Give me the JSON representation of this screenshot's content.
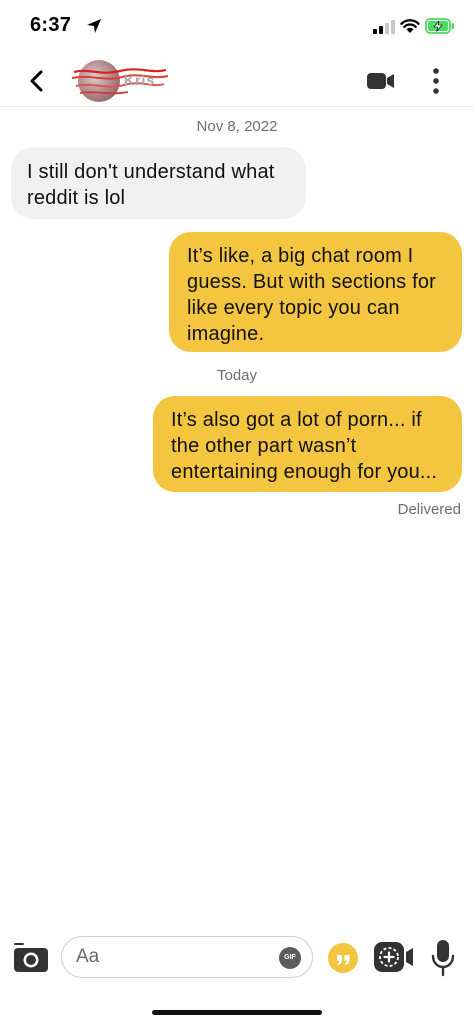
{
  "status_bar": {
    "time": "6:37"
  },
  "header": {
    "contact_name": "Kris"
  },
  "messages": [
    {
      "type": "date",
      "text": "Nov 8, 2022"
    },
    {
      "type": "incoming",
      "text": "I still don't understand what reddit is lol"
    },
    {
      "type": "outgoing",
      "text": "It’s like, a big chat room I guess. But with sections for like every topic you can imagine."
    },
    {
      "type": "date",
      "text": "Today"
    },
    {
      "type": "outgoing",
      "text": "It’s also got a lot of porn... if the other part wasn’t entertaining enough for you..."
    }
  ],
  "delivery_status": "Delivered",
  "composer": {
    "placeholder": "Aa",
    "gif_label": "GIF"
  },
  "colors": {
    "outgoing_bubble": "#f4c53f",
    "incoming_bubble": "#f1f1f1",
    "accent": "#f4c53f",
    "battery_charging": "#4cd964"
  },
  "icons": {
    "status": [
      "location-arrow-icon",
      "cellular-signal-icon",
      "wifi-icon",
      "battery-charging-icon"
    ],
    "header": [
      "back-chevron-icon",
      "video-camera-icon",
      "more-vertical-icon"
    ],
    "composer": [
      "camera-icon",
      "gif-icon",
      "quote-icon",
      "media-add-icon",
      "microphone-icon"
    ]
  }
}
